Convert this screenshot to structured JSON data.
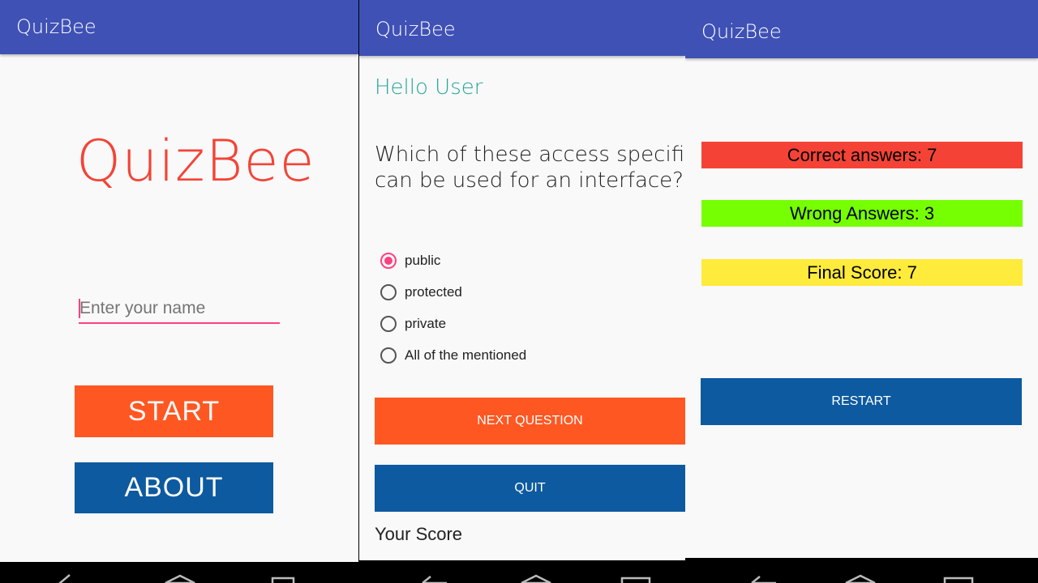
{
  "app_title": "QuizBee",
  "home": {
    "logo_text": "QuizBee",
    "name_input": {
      "value": "",
      "placeholder": "Enter your name"
    },
    "start_label": "START",
    "about_label": "ABOUT"
  },
  "quiz": {
    "greeting": "Hello User",
    "question_line1": "Which of these access specifiers",
    "question_line2": "can be used for an interface?",
    "options": [
      {
        "label": "public",
        "checked": true
      },
      {
        "label": "protected",
        "checked": false
      },
      {
        "label": "private",
        "checked": false
      },
      {
        "label": "All of the mentioned",
        "checked": false
      }
    ],
    "next_label": "NEXT QUESTION",
    "quit_label": "QUIT",
    "score_label": "Your Score"
  },
  "results": {
    "correct": "Correct answers: 7",
    "wrong": "Wrong Answers: 3",
    "final": "Final Score: 7",
    "restart_label": "RESTART"
  },
  "colors": {
    "appbar": "#3f51b5",
    "accent_orange": "#ff5722",
    "button_blue": "#0d5aa0",
    "logo_red": "#f44336",
    "greeting_teal": "#26a69a",
    "radio_pink": "#ff4081",
    "correct_red": "#f44336",
    "wrong_green": "#76ff03",
    "final_yellow": "#ffeb3b"
  },
  "icons": [
    "back-icon",
    "home-icon",
    "recents-icon"
  ]
}
